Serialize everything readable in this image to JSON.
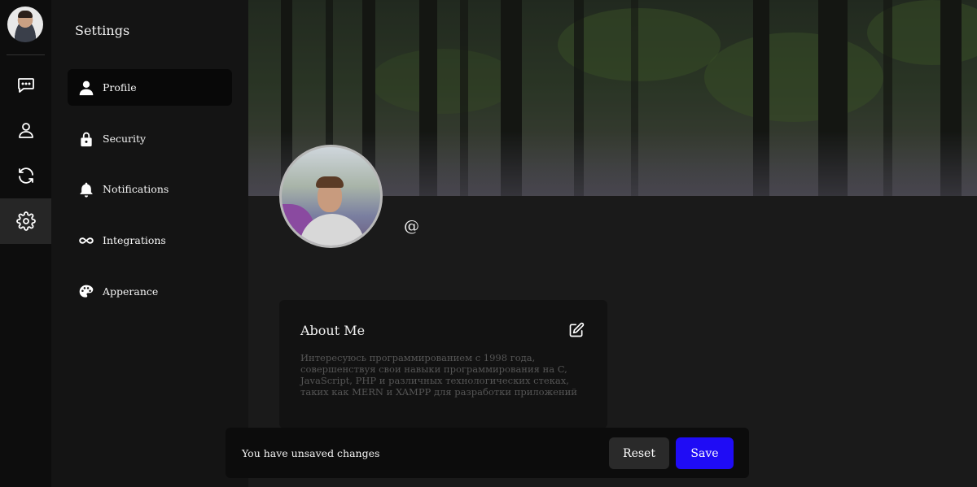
{
  "rail": {
    "items": [
      {
        "name": "chat-icon"
      },
      {
        "name": "user-icon"
      },
      {
        "name": "refresh-icon"
      },
      {
        "name": "gear-icon",
        "active": true
      }
    ]
  },
  "sidebar": {
    "title": "Settings",
    "items": [
      {
        "label": "Profile",
        "icon": "user-silhouette-icon",
        "active": true
      },
      {
        "label": "Security",
        "icon": "lock-icon"
      },
      {
        "label": "Notifications",
        "icon": "bell-icon"
      },
      {
        "label": "Integrations",
        "icon": "infinity-icon"
      },
      {
        "label": "Apperance",
        "icon": "palette-icon"
      }
    ]
  },
  "profile": {
    "handle": "@"
  },
  "about": {
    "title": "About Me",
    "text": "Интересуюсь программированием с 1998 года, совершенствуя свои навыки программирования на C, JavaScript, PHP и различных технологических стеках, таких как MERN и XAMPP для разработки приложений"
  },
  "unsaved": {
    "message": "You have unsaved changes",
    "reset_label": "Reset",
    "save_label": "Save"
  },
  "colors": {
    "accent": "#1f0cf5",
    "background": "#1a1a1a",
    "sidebar": "#141414",
    "rail": "#0d0d0d"
  }
}
